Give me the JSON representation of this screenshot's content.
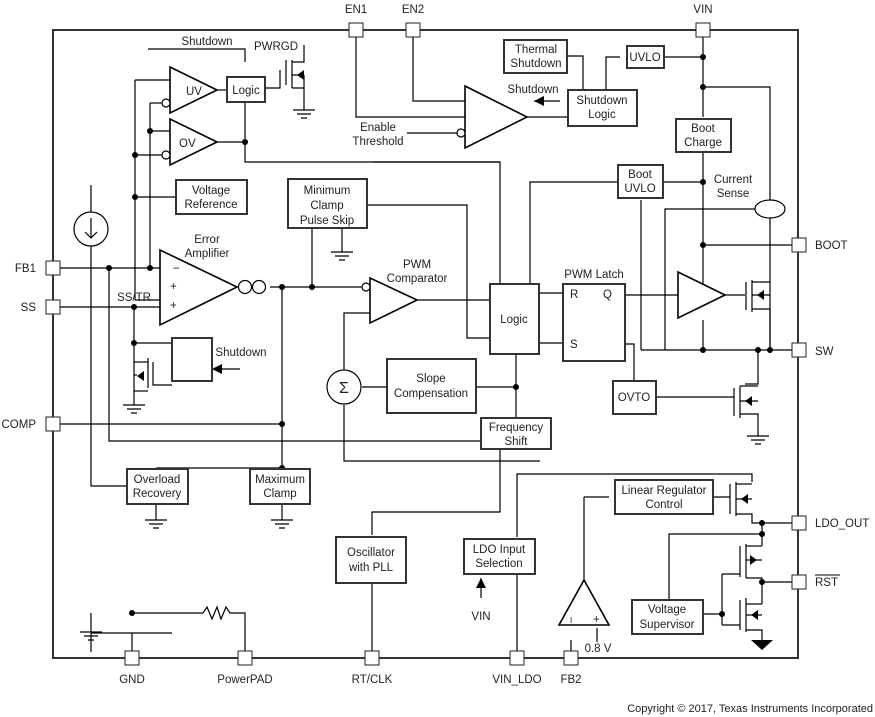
{
  "diagram": {
    "pins": {
      "en1": "EN1",
      "en2": "EN2",
      "vin": "VIN",
      "boot": "BOOT",
      "sw": "SW",
      "ldo_out": "LDO_OUT",
      "rst": "RST",
      "fb1": "FB1",
      "ss": "SS",
      "comp": "COMP",
      "gnd": "GND",
      "powerpad": "PowerPAD",
      "rt_clk": "RT/CLK",
      "vin_ldo": "VIN_LDO",
      "fb2": "FB2"
    },
    "blocks": {
      "logic_pg": "Logic",
      "voltage_reference": [
        "Voltage",
        "Reference"
      ],
      "min_clamp": [
        "Minimum",
        "Clamp",
        "Pulse Skip"
      ],
      "thermal_shutdown": [
        "Thermal",
        "Shutdown"
      ],
      "uvlo": "UVLO",
      "shutdown_logic": [
        "Shutdown",
        "Logic"
      ],
      "boot_charge": [
        "Boot",
        "Charge"
      ],
      "boot_uvlo": [
        "Boot",
        "UVLO"
      ],
      "logic_main": "Logic",
      "slope_comp": [
        "Slope",
        "Compensation"
      ],
      "freq_shift": [
        "Frequency",
        "Shift"
      ],
      "ovto": "OVTO",
      "overload_recovery": [
        "Overload",
        "Recovery"
      ],
      "max_clamp": [
        "Maximum",
        "Clamp"
      ],
      "oscillator": [
        "Oscillator",
        "with PLL"
      ],
      "ldo_input_sel": [
        "LDO Input",
        "Selection"
      ],
      "linear_reg": [
        "Linear Regulator",
        "Control"
      ],
      "voltage_supervisor": [
        "Voltage",
        "Supervisor"
      ]
    },
    "labels": {
      "shutdown_top": "Shutdown",
      "pwrgd": "PWRGD",
      "uv": "UV",
      "ov": "OV",
      "enable_threshold": [
        "Enable",
        "Threshold"
      ],
      "shutdown_en": "Shutdown",
      "error_amp": [
        "Error",
        "Amplifier"
      ],
      "minus": "−",
      "plus1": "+",
      "plus2": "+",
      "ss_tr": "SS/TR",
      "shutdown_ss": "Shutdown",
      "pwm_comparator": [
        "PWM",
        "Comparator"
      ],
      "pwm_latch": "PWM Latch",
      "latch_r": "R",
      "latch_q": "Q",
      "latch_s": "S",
      "current_sense": [
        "Current",
        "Sense"
      ],
      "sigma": "Σ",
      "vin_arrow": "VIN",
      "ldo_amp_minus": "I",
      "ldo_amp_plus": "+",
      "ref_08v": "0.8 V"
    },
    "copyright": "Copyright © 2017, Texas Instruments Incorporated"
  }
}
